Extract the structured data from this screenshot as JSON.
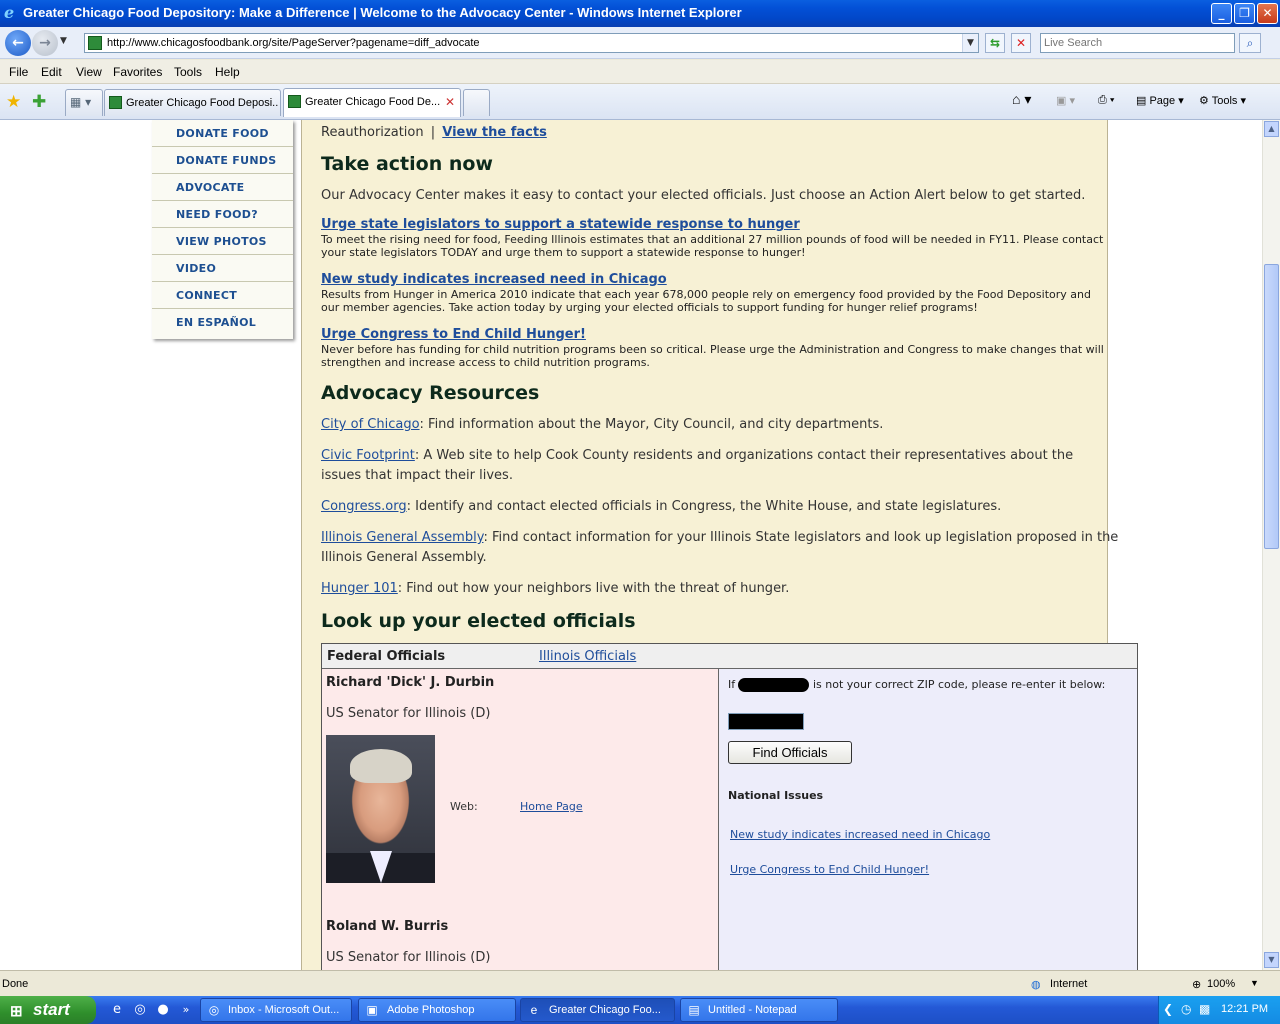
{
  "window": {
    "title": "Greater Chicago Food Depository: Make a Difference | Welcome to the Advocacy Center - Windows Internet Explorer"
  },
  "address_bar": {
    "url": "http://www.chicagosfoodbank.org/site/PageServer?pagename=diff_advocate",
    "search_placeholder": "Live Search"
  },
  "menu": [
    "File",
    "Edit",
    "View",
    "Favorites",
    "Tools",
    "Help"
  ],
  "tabs": [
    {
      "label": "Greater Chicago Food Deposi...",
      "active": false
    },
    {
      "label": "Greater Chicago Food De...",
      "active": true
    }
  ],
  "command_bar": {
    "page_label": "Page",
    "tools_label": "Tools"
  },
  "left_nav": [
    "DONATE FOOD",
    "DONATE FUNDS",
    "ADVOCATE",
    "NEED FOOD?",
    "VIEW PHOTOS",
    "VIDEO",
    "CONNECT",
    "EN ESPAÑOL"
  ],
  "main": {
    "top_line_text": "Reauthorization",
    "top_line_sep": "|",
    "top_line_link": "View the facts",
    "take_action_heading": "Take action now",
    "take_action_intro": "Our Advocacy Center makes it easy to contact your elected officials. Just choose an Action Alert below to get started.",
    "alerts": [
      {
        "title": "Urge state legislators to support a statewide response to hunger",
        "line1": "To meet the rising need for food, Feeding Illinois estimates that an additional 27 million pounds of food will be needed in FY11. Please contact",
        "line2": "your state legislators TODAY and urge them to support a statewide response to hunger!"
      },
      {
        "title": "New study indicates increased need in Chicago",
        "line1": "Results from Hunger in America 2010 indicate that each year 678,000 people rely on emergency food provided by the Food Depository and",
        "line2": "our member agencies. Take action today by urging your elected officials to support funding for hunger relief programs!"
      },
      {
        "title": "Urge Congress to End Child Hunger!",
        "line1": "Never before has funding for child nutrition programs been so critical. Please urge the Administration and Congress to make changes that will",
        "line2": "strengthen and increase access to child nutrition programs."
      }
    ],
    "resources_heading": "Advocacy Resources",
    "resources": [
      {
        "link": "City of Chicago",
        "text": ": Find information about the Mayor, City Council, and city departments.",
        "text2": ""
      },
      {
        "link": "Civic Footprint",
        "text": ": A Web site to help Cook County residents and organizations contact their representatives about the",
        "text2": "issues that impact their lives."
      },
      {
        "link": "Congress.org",
        "text": ": Identify and contact elected officials in Congress, the White House, and state legislatures.",
        "text2": ""
      },
      {
        "link": "Illinois General Assembly",
        "text": ": Find contact information for your Illinois State legislators and look up legislation proposed in the",
        "text2": "Illinois General Assembly."
      },
      {
        "link": "Hunger 101",
        "text": ": Find out how your neighbors live with the threat of hunger.",
        "text2": ""
      }
    ],
    "lookup_heading": "Look up your elected officials"
  },
  "officials": {
    "tab_federal": "Federal Officials",
    "tab_illinois": "Illinois Officials",
    "people": [
      {
        "name": "Richard 'Dick' J. Durbin",
        "role": "US Senator for Illinois (D)",
        "web_label": "Web:",
        "web_link": "Home Page"
      },
      {
        "name": "Roland W. Burris",
        "role": "US Senator for Illinois (D)"
      }
    ],
    "zip_prefix": "If",
    "zip_suffix": "is not your correct ZIP code, please re-enter it below:",
    "find_button": "Find Officials",
    "national_heading": "National Issues",
    "national_links": [
      "New study indicates increased need in Chicago",
      "Urge Congress to End Child Hunger!"
    ]
  },
  "status_bar": {
    "left": "Done",
    "zone": "Internet",
    "zoom": "100%"
  },
  "taskbar": {
    "start": "start",
    "tasks": [
      {
        "label": "Inbox - Microsoft Out...",
        "active": false
      },
      {
        "label": "Adobe Photoshop",
        "active": false
      },
      {
        "label": "Greater Chicago Foo...",
        "active": true
      },
      {
        "label": "Untitled - Notepad",
        "active": false
      }
    ],
    "clock": "12:21 PM"
  }
}
